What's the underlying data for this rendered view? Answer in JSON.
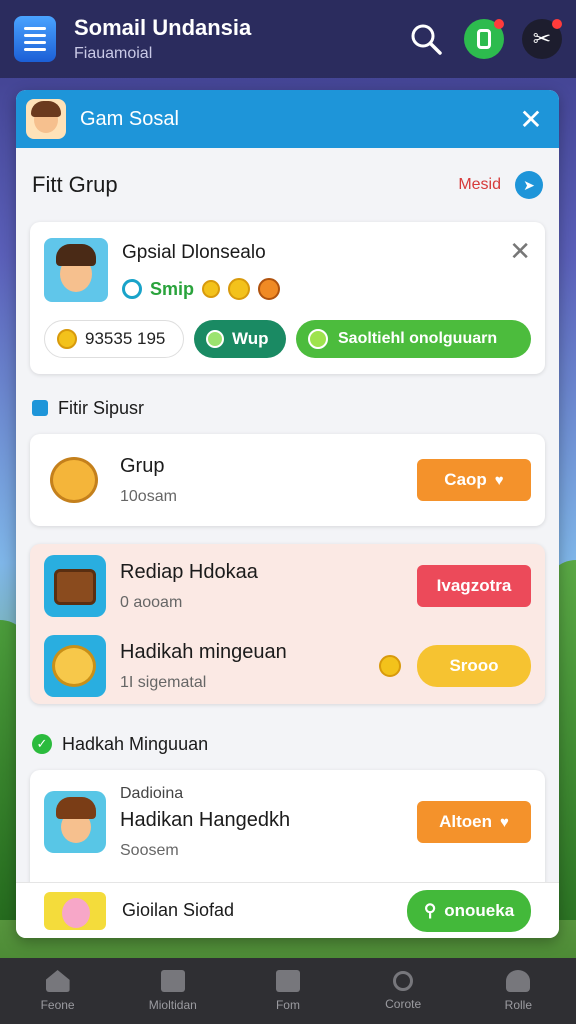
{
  "appbar": {
    "title": "Somail Undansia",
    "subtitle": "Fiauamoial",
    "icons": [
      "search-icon",
      "phone-icon",
      "tools-icon"
    ]
  },
  "panel": {
    "header_title": "Gam Sosal",
    "section_title": "Fitt Grup",
    "medal_link": "Mesid",
    "social_card": {
      "name": "Gpsial Dlonsealo",
      "tag": "Smip",
      "count": "93535 195",
      "wup_label": "Wup",
      "social_label": "Saoltiehl onolguuarn"
    },
    "fitur_heading": "Fitir Sipusr",
    "grup_item": {
      "title": "Grup",
      "sub": "10osam",
      "button": "Caop"
    },
    "pink_items": [
      {
        "title": "Rediap Hdokaa",
        "sub": "0 aooam",
        "button": "Ivagzotra"
      },
      {
        "title": "Hadikah mingeuan",
        "sub": "1I sigematal",
        "button": "Srooo"
      }
    ],
    "hadikah_heading": "Hadkah Minguuan",
    "hadikah_item": {
      "kicker": "Dadioina",
      "title": "Hadikan Hangedkh",
      "sub": "Soosem",
      "button": "Altoen"
    },
    "strip": {
      "label": "Gioilan Siofad",
      "button": "onoueka"
    }
  },
  "nav": [
    {
      "label": "Feone",
      "icon": "home-icon"
    },
    {
      "label": "Mioltidan",
      "icon": "chart-icon"
    },
    {
      "label": "Fom",
      "icon": "square-icon"
    },
    {
      "label": "Corote",
      "icon": "search-icon"
    },
    {
      "label": "Rolle",
      "icon": "person-icon"
    }
  ]
}
